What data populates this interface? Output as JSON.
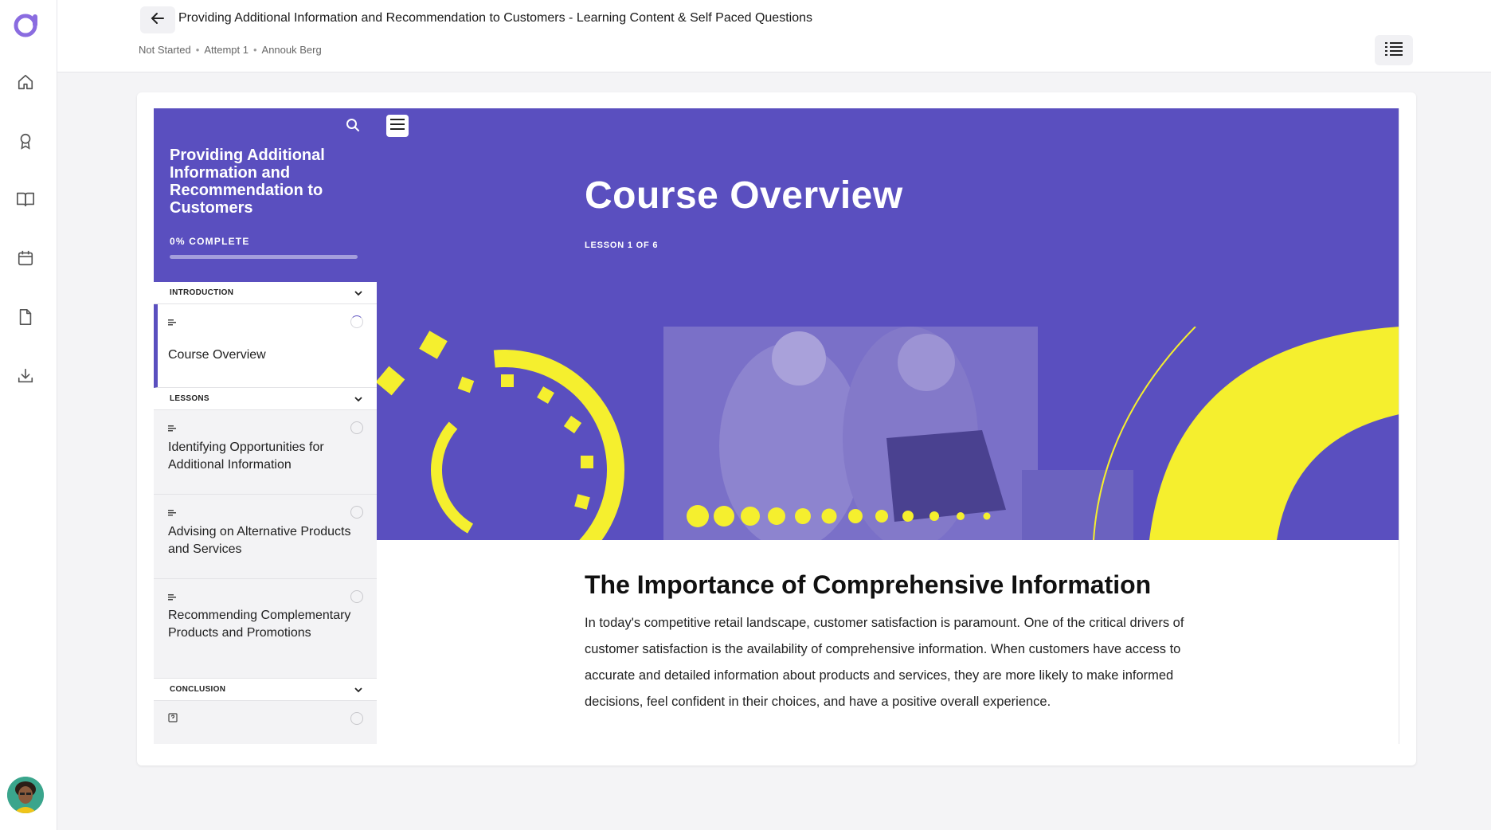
{
  "header": {
    "title": "Providing Additional Information and Recommendation to Customers - Learning Content & Self Paced Questions",
    "status": "Not Started",
    "attempt": "Attempt 1",
    "learner": "Annouk Berg"
  },
  "rail": {
    "items": [
      "home-icon",
      "award-icon",
      "book-icon",
      "calendar-icon",
      "document-icon",
      "download-icon"
    ]
  },
  "course": {
    "title": "Providing Additional Information and Recommendation to Customers",
    "progress_text": "0% COMPLETE",
    "progress_fraction": 0.0,
    "sections": [
      {
        "label": "INTRODUCTION",
        "lessons": [
          {
            "title": "Course Overview",
            "active": true
          }
        ]
      },
      {
        "label": "LESSONS",
        "lessons": [
          {
            "title": "Identifying Opportunities for Additional Information"
          },
          {
            "title": "Advising on Alternative Products and Services"
          },
          {
            "title": "Recommending Complementary Products and Promotions"
          }
        ]
      },
      {
        "label": "CONCLUSION",
        "lessons": [
          {
            "title": ""
          }
        ]
      }
    ]
  },
  "lesson": {
    "title": "Course Overview",
    "counter": "LESSON 1 OF 6",
    "heading": "The Importance of Comprehensive Information",
    "paragraph": "In today's competitive retail landscape, customer satisfaction is paramount. One of the critical drivers of customer satisfaction is the availability of comprehensive information. When customers have access to accurate and detailed information about products and services, they are more likely to make informed decisions, feel confident in their choices, and have a positive overall experience."
  },
  "colors": {
    "brand": "#5a4fbf",
    "accent_yellow": "#f5ef2e"
  }
}
